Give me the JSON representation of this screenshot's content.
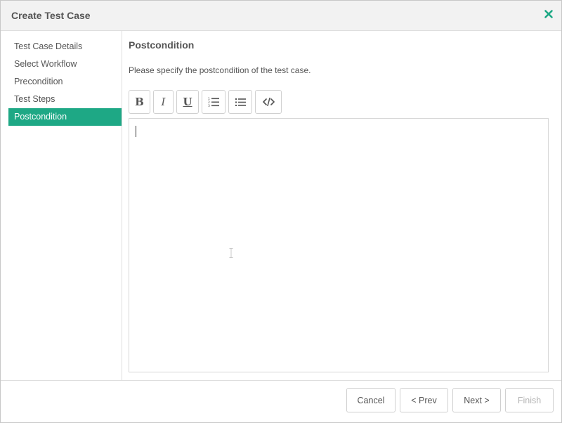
{
  "dialog": {
    "title": "Create Test Case",
    "accent_color": "#1ea885",
    "close_icon": "close-icon"
  },
  "sidebar": {
    "items": [
      {
        "label": "Test Case Details",
        "active": false
      },
      {
        "label": "Select Workflow",
        "active": false
      },
      {
        "label": "Precondition",
        "active": false
      },
      {
        "label": "Test Steps",
        "active": false
      },
      {
        "label": "Postcondition",
        "active": true
      }
    ]
  },
  "main": {
    "title": "Postcondition",
    "description": "Please specify the postcondition of the test case.",
    "toolbar": {
      "bold_glyph": "B",
      "italic_glyph": "I",
      "underline_glyph": "U",
      "icons": [
        "bold-icon",
        "italic-icon",
        "underline-icon",
        "ordered-list-icon",
        "unordered-list-icon",
        "code-view-icon"
      ]
    },
    "editor": {
      "value": ""
    }
  },
  "footer": {
    "cancel_label": "Cancel",
    "prev_label": "< Prev",
    "next_label": "Next >",
    "finish_label": "Finish",
    "finish_disabled": true
  }
}
